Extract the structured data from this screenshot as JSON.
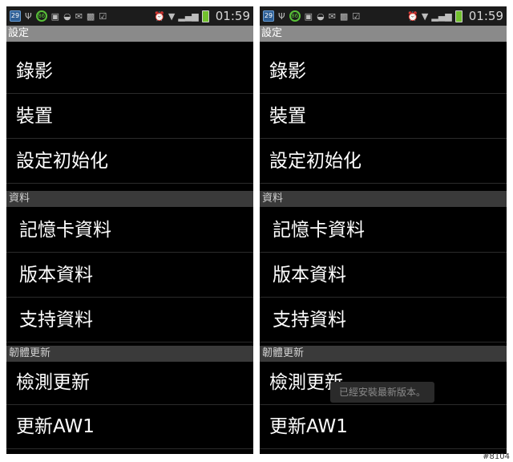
{
  "status_bar": {
    "calendar_date": "29",
    "battery_percent": "86",
    "time": "01:59",
    "icons": [
      "calendar-icon",
      "usb-icon",
      "battery-percent-icon",
      "image-icon",
      "notification-icon",
      "mail-icon",
      "photo-icon",
      "clipboard-check-icon",
      "alarm-icon",
      "wifi-icon",
      "signal-icon",
      "battery-icon"
    ]
  },
  "title": "設定",
  "settings_items": [
    {
      "label": "錄影"
    },
    {
      "label": "裝置"
    },
    {
      "label": "設定初始化"
    }
  ],
  "section_info": "資料",
  "info_items": [
    {
      "label": "記憶卡資料"
    },
    {
      "label": "版本資料"
    },
    {
      "label": "支持資料"
    }
  ],
  "section_firmware": "韌體更新",
  "firmware_items": [
    {
      "label": "檢測更新"
    },
    {
      "label": "更新AW1"
    }
  ],
  "toast_message": "已經安裝最新版本。",
  "watermark": "#8104"
}
